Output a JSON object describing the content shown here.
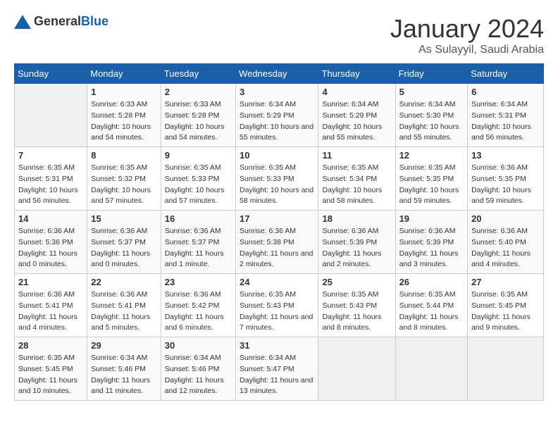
{
  "header": {
    "logo_general": "General",
    "logo_blue": "Blue",
    "month": "January 2024",
    "location": "As Sulayyil, Saudi Arabia"
  },
  "weekdays": [
    "Sunday",
    "Monday",
    "Tuesday",
    "Wednesday",
    "Thursday",
    "Friday",
    "Saturday"
  ],
  "weeks": [
    [
      {
        "day": "",
        "sunrise": "",
        "sunset": "",
        "daylight": ""
      },
      {
        "day": "1",
        "sunrise": "Sunrise: 6:33 AM",
        "sunset": "Sunset: 5:28 PM",
        "daylight": "Daylight: 10 hours and 54 minutes."
      },
      {
        "day": "2",
        "sunrise": "Sunrise: 6:33 AM",
        "sunset": "Sunset: 5:28 PM",
        "daylight": "Daylight: 10 hours and 54 minutes."
      },
      {
        "day": "3",
        "sunrise": "Sunrise: 6:34 AM",
        "sunset": "Sunset: 5:29 PM",
        "daylight": "Daylight: 10 hours and 55 minutes."
      },
      {
        "day": "4",
        "sunrise": "Sunrise: 6:34 AM",
        "sunset": "Sunset: 5:29 PM",
        "daylight": "Daylight: 10 hours and 55 minutes."
      },
      {
        "day": "5",
        "sunrise": "Sunrise: 6:34 AM",
        "sunset": "Sunset: 5:30 PM",
        "daylight": "Daylight: 10 hours and 55 minutes."
      },
      {
        "day": "6",
        "sunrise": "Sunrise: 6:34 AM",
        "sunset": "Sunset: 5:31 PM",
        "daylight": "Daylight: 10 hours and 56 minutes."
      }
    ],
    [
      {
        "day": "7",
        "sunrise": "Sunrise: 6:35 AM",
        "sunset": "Sunset: 5:31 PM",
        "daylight": "Daylight: 10 hours and 56 minutes."
      },
      {
        "day": "8",
        "sunrise": "Sunrise: 6:35 AM",
        "sunset": "Sunset: 5:32 PM",
        "daylight": "Daylight: 10 hours and 57 minutes."
      },
      {
        "day": "9",
        "sunrise": "Sunrise: 6:35 AM",
        "sunset": "Sunset: 5:33 PM",
        "daylight": "Daylight: 10 hours and 57 minutes."
      },
      {
        "day": "10",
        "sunrise": "Sunrise: 6:35 AM",
        "sunset": "Sunset: 5:33 PM",
        "daylight": "Daylight: 10 hours and 58 minutes."
      },
      {
        "day": "11",
        "sunrise": "Sunrise: 6:35 AM",
        "sunset": "Sunset: 5:34 PM",
        "daylight": "Daylight: 10 hours and 58 minutes."
      },
      {
        "day": "12",
        "sunrise": "Sunrise: 6:35 AM",
        "sunset": "Sunset: 5:35 PM",
        "daylight": "Daylight: 10 hours and 59 minutes."
      },
      {
        "day": "13",
        "sunrise": "Sunrise: 6:36 AM",
        "sunset": "Sunset: 5:35 PM",
        "daylight": "Daylight: 10 hours and 59 minutes."
      }
    ],
    [
      {
        "day": "14",
        "sunrise": "Sunrise: 6:36 AM",
        "sunset": "Sunset: 5:36 PM",
        "daylight": "Daylight: 11 hours and 0 minutes."
      },
      {
        "day": "15",
        "sunrise": "Sunrise: 6:36 AM",
        "sunset": "Sunset: 5:37 PM",
        "daylight": "Daylight: 11 hours and 0 minutes."
      },
      {
        "day": "16",
        "sunrise": "Sunrise: 6:36 AM",
        "sunset": "Sunset: 5:37 PM",
        "daylight": "Daylight: 11 hours and 1 minute."
      },
      {
        "day": "17",
        "sunrise": "Sunrise: 6:36 AM",
        "sunset": "Sunset: 5:38 PM",
        "daylight": "Daylight: 11 hours and 2 minutes."
      },
      {
        "day": "18",
        "sunrise": "Sunrise: 6:36 AM",
        "sunset": "Sunset: 5:39 PM",
        "daylight": "Daylight: 11 hours and 2 minutes."
      },
      {
        "day": "19",
        "sunrise": "Sunrise: 6:36 AM",
        "sunset": "Sunset: 5:39 PM",
        "daylight": "Daylight: 11 hours and 3 minutes."
      },
      {
        "day": "20",
        "sunrise": "Sunrise: 6:36 AM",
        "sunset": "Sunset: 5:40 PM",
        "daylight": "Daylight: 11 hours and 4 minutes."
      }
    ],
    [
      {
        "day": "21",
        "sunrise": "Sunrise: 6:36 AM",
        "sunset": "Sunset: 5:41 PM",
        "daylight": "Daylight: 11 hours and 4 minutes."
      },
      {
        "day": "22",
        "sunrise": "Sunrise: 6:36 AM",
        "sunset": "Sunset: 5:41 PM",
        "daylight": "Daylight: 11 hours and 5 minutes."
      },
      {
        "day": "23",
        "sunrise": "Sunrise: 6:36 AM",
        "sunset": "Sunset: 5:42 PM",
        "daylight": "Daylight: 11 hours and 6 minutes."
      },
      {
        "day": "24",
        "sunrise": "Sunrise: 6:35 AM",
        "sunset": "Sunset: 5:43 PM",
        "daylight": "Daylight: 11 hours and 7 minutes."
      },
      {
        "day": "25",
        "sunrise": "Sunrise: 6:35 AM",
        "sunset": "Sunset: 5:43 PM",
        "daylight": "Daylight: 11 hours and 8 minutes."
      },
      {
        "day": "26",
        "sunrise": "Sunrise: 6:35 AM",
        "sunset": "Sunset: 5:44 PM",
        "daylight": "Daylight: 11 hours and 8 minutes."
      },
      {
        "day": "27",
        "sunrise": "Sunrise: 6:35 AM",
        "sunset": "Sunset: 5:45 PM",
        "daylight": "Daylight: 11 hours and 9 minutes."
      }
    ],
    [
      {
        "day": "28",
        "sunrise": "Sunrise: 6:35 AM",
        "sunset": "Sunset: 5:45 PM",
        "daylight": "Daylight: 11 hours and 10 minutes."
      },
      {
        "day": "29",
        "sunrise": "Sunrise: 6:34 AM",
        "sunset": "Sunset: 5:46 PM",
        "daylight": "Daylight: 11 hours and 11 minutes."
      },
      {
        "day": "30",
        "sunrise": "Sunrise: 6:34 AM",
        "sunset": "Sunset: 5:46 PM",
        "daylight": "Daylight: 11 hours and 12 minutes."
      },
      {
        "day": "31",
        "sunrise": "Sunrise: 6:34 AM",
        "sunset": "Sunset: 5:47 PM",
        "daylight": "Daylight: 11 hours and 13 minutes."
      },
      {
        "day": "",
        "sunrise": "",
        "sunset": "",
        "daylight": ""
      },
      {
        "day": "",
        "sunrise": "",
        "sunset": "",
        "daylight": ""
      },
      {
        "day": "",
        "sunrise": "",
        "sunset": "",
        "daylight": ""
      }
    ]
  ]
}
